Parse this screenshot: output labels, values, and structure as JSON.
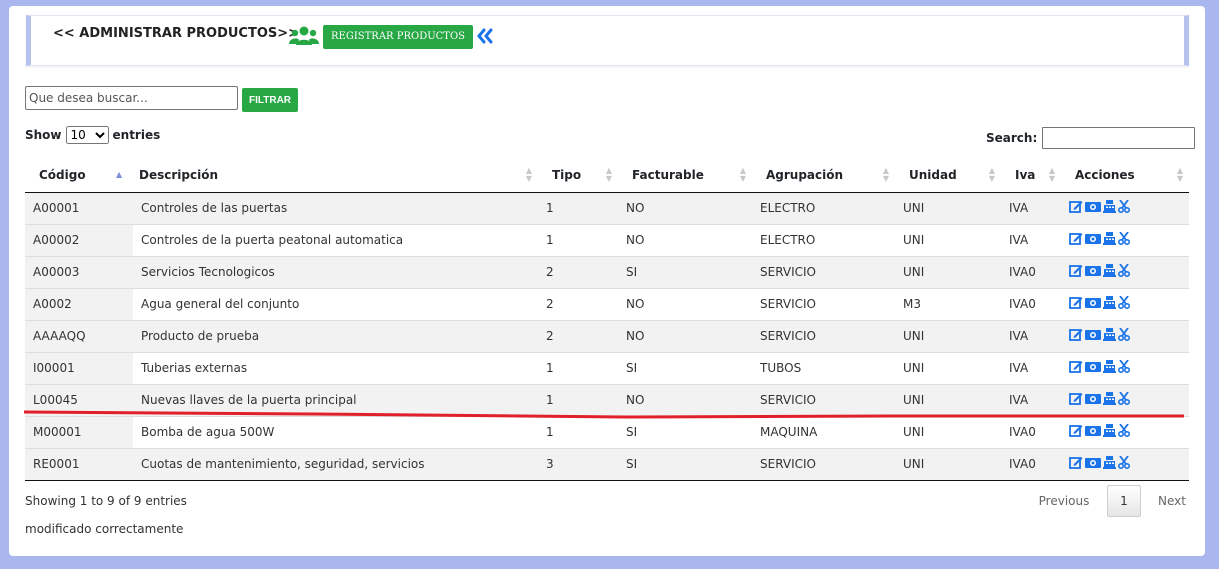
{
  "header": {
    "title": "<< ADMINISTRAR PRODUCTOS>>",
    "register_label": "REGISTRAR PRODUCTOS"
  },
  "filter": {
    "placeholder": "Que desea buscar...",
    "button_label": "FILTRAR"
  },
  "length_menu": {
    "prefix": "Show",
    "selected": "10",
    "suffix": "entries"
  },
  "search_label": "Search:",
  "table": {
    "columns": [
      "Código",
      "Descripción",
      "Tipo",
      "Facturable",
      "Agrupación",
      "Unidad",
      "Iva",
      "Acciones"
    ],
    "rows": [
      [
        "A00001",
        "Controles de las puertas",
        "1",
        "NO",
        "ELECTRO",
        "UNI",
        "IVA"
      ],
      [
        "A00002",
        "Controles de la puerta peatonal automatica",
        "1",
        "NO",
        "ELECTRO",
        "UNI",
        "IVA"
      ],
      [
        "A00003",
        "Servicios Tecnologicos",
        "2",
        "SI",
        "SERVICIO",
        "UNI",
        "IVA0"
      ],
      [
        "A0002",
        "Agua general del conjunto",
        "2",
        "NO",
        "SERVICIO",
        "M3",
        "IVA0"
      ],
      [
        "AAAAQQ",
        "Producto de prueba",
        "2",
        "NO",
        "SERVICIO",
        "UNI",
        "IVA"
      ],
      [
        "I00001",
        "Tuberias externas",
        "1",
        "SI",
        "TUBOS",
        "UNI",
        "IVA"
      ],
      [
        "L00045",
        "Nuevas llaves de la puerta principal",
        "1",
        "NO",
        "SERVICIO",
        "UNI",
        "IVA"
      ],
      [
        "M00001",
        "Bomba de agua 500W",
        "1",
        "SI",
        "MAQUINA",
        "UNI",
        "IVA0"
      ],
      [
        "RE0001",
        "Cuotas de mantenimiento, seguridad, servicios",
        "3",
        "SI",
        "SERVICIO",
        "UNI",
        "IVA0"
      ]
    ],
    "action_icons": [
      "edit-icon",
      "money-icon",
      "cash-register-icon",
      "scissors-icon"
    ]
  },
  "info": "Showing 1 to 9 of 9 entries",
  "message": "modificado correctamente",
  "pagination": {
    "previous": "Previous",
    "current": "1",
    "next": "Next"
  },
  "colors": {
    "accent_green": "#28a745",
    "icon_blue": "#1a73e8",
    "highlight_red": "#e0202a"
  }
}
